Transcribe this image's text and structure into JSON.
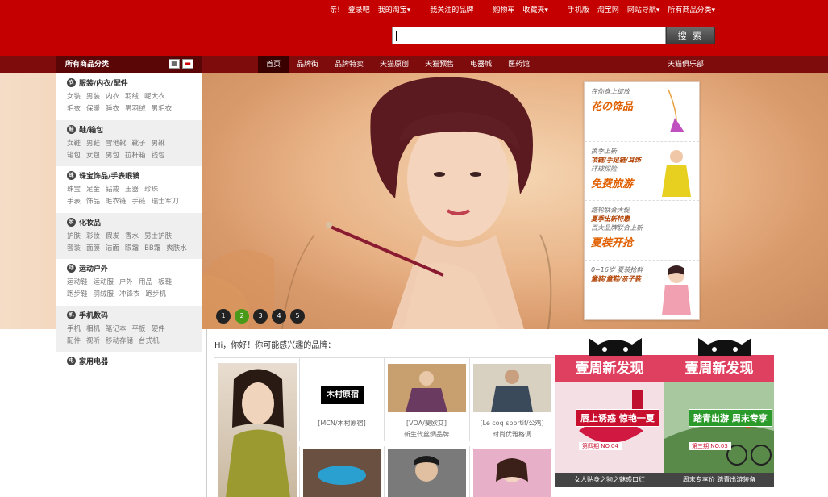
{
  "topbar": {
    "links": [
      "亲!",
      "登录吧",
      "我的淘宝",
      "我关注的品牌",
      "购物车",
      "收藏夹",
      "手机版",
      "淘宝网",
      "网站导航",
      "所有商品分类"
    ],
    "search_button": "搜 索",
    "search_value": ""
  },
  "nav": {
    "category_header": "所有商品分类",
    "items": [
      "首页",
      "品牌街",
      "品牌特卖",
      "天猫原创",
      "天猫预售",
      "电器城",
      "医药馆"
    ],
    "club": "天猫俱乐部"
  },
  "sidebar": {
    "categories": [
      {
        "title": "服装/内衣/配件",
        "row1": [
          "女装",
          "男装",
          "内衣",
          "羽绒",
          "呢大衣"
        ],
        "row2": [
          "毛衣",
          "保暖",
          "睡衣",
          "男羽绒",
          "男毛衣"
        ]
      },
      {
        "title": "鞋/箱包",
        "row1": [
          "女鞋",
          "男鞋",
          "雪地靴",
          "靴子",
          "男靴"
        ],
        "row2": [
          "箱包",
          "女包",
          "男包",
          "拉杆箱",
          "钱包"
        ]
      },
      {
        "title": "珠宝饰品/手表眼镜",
        "row1": [
          "珠宝",
          "足金",
          "钻戒",
          "玉器",
          "珍珠"
        ],
        "row2": [
          "手表",
          "饰品",
          "毛衣链",
          "手链",
          "瑞士军刀"
        ]
      },
      {
        "title": "化妆品",
        "row1": [
          "护肤",
          "彩妆",
          "假发",
          "香水",
          "男士护肤"
        ],
        "row2": [
          "套装",
          "面膜",
          "洁面",
          "眼霜",
          "BB霜",
          "爽肤水"
        ]
      },
      {
        "title": "运动户外",
        "row1": [
          "运动鞋",
          "运动服",
          "户外",
          "用品",
          "板鞋"
        ],
        "row2": [
          "跑步鞋",
          "羽绒服",
          "冲锋衣",
          "跑步机"
        ]
      },
      {
        "title": "手机数码",
        "row1": [
          "手机",
          "相机",
          "笔记本",
          "平板",
          "硬件"
        ],
        "row2": [
          "配件",
          "视听",
          "移动存储",
          "台式机"
        ]
      },
      {
        "title": "家用电器",
        "row1": [],
        "row2": []
      }
    ]
  },
  "banner": {
    "panel": [
      {
        "small": "在你身上绽放",
        "big": "花の饰品"
      },
      {
        "small": "换季上新",
        "big": "项链/手足链/耳饰"
      },
      {
        "small": "环球探险",
        "big": "免费旅游"
      },
      {
        "small": "踏轮联合大促",
        "big": "夏季出新特惠"
      },
      {
        "small": "百大品牌联合上新",
        "big": "夏装开抢"
      },
      {
        "small": "0~16岁 夏装抢鲜",
        "big": "童装/童鞋/亲子装"
      }
    ],
    "dots": [
      "1",
      "2",
      "3",
      "4",
      "5"
    ],
    "active_dot": 2
  },
  "brands": {
    "greeting": "Hi，你好！你可能感兴趣的品牌：",
    "items": [
      {
        "logo": "木村原宿",
        "caption1": "[MCN/木村原宿]",
        "caption2": ""
      },
      {
        "caption1": "[VOA/斐欧艾]",
        "caption2": "新生代丝绸品牌"
      },
      {
        "caption1": "[Le coq sportif/公鸡]",
        "caption2": "时尚优雅格调"
      }
    ]
  },
  "promos": [
    {
      "head": "壹周新发现",
      "badge": "唇上诱惑 惊艳一夏",
      "issue": "第四期 NO.04",
      "foot": "女人贴身之物之魅惑口红"
    },
    {
      "head": "壹周新发现",
      "badge": "踏青出游 周末专享",
      "issue": "第三期 NO.03",
      "foot": "周末专享价 踏青出游装备"
    }
  ],
  "colors": {
    "brand_red": "#c50000",
    "nav_dark": "#7e0c0c",
    "active_dot": "#4a9a1a",
    "promo_pink": "#e04060"
  }
}
